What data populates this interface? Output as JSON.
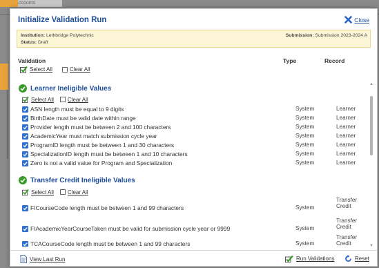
{
  "background": {
    "crumb": "Code Accounts"
  },
  "dialog": {
    "title": "Initialize Validation Run",
    "close_label": "Close",
    "info": {
      "institution_label": "Institution:",
      "institution_value": "Lethbridge Polytechnic",
      "status_label": "Status:",
      "status_value": "Draft",
      "submission_label": "Submission:",
      "submission_value": "Submission 2023-2024 A"
    },
    "columns": {
      "validation": "Validation",
      "type": "Type",
      "record": "Record"
    },
    "select_all": "Select All",
    "clear_all": "Clear All",
    "sections": [
      {
        "title": "Learner Ineligible Values",
        "select_all": "Select All",
        "clear_all": "Clear All",
        "rows": [
          {
            "text": "ASN length must be equal to 9 digits",
            "type": "System",
            "record": "Learner"
          },
          {
            "text": "BirthDate must be valid date within range",
            "type": "System",
            "record": "Learner"
          },
          {
            "text": "Provider length must be between 2 and 100 characters",
            "type": "System",
            "record": "Learner"
          },
          {
            "text": "AcademicYear must match submission cycle year",
            "type": "System",
            "record": "Learner"
          },
          {
            "text": "ProgramID length must be between 1 and 30 characters",
            "type": "System",
            "record": "Learner"
          },
          {
            "text": "SpecializationID length must be between 1 and 10 characters",
            "type": "System",
            "record": "Learner"
          },
          {
            "text": "Zero is not a valid value for Program and Specialization",
            "type": "System",
            "record": "Learner"
          }
        ]
      },
      {
        "title": "Transfer Credit Ineligible Values",
        "select_all": "Select All",
        "clear_all": "Clear All",
        "rows": [
          {
            "text": "FICourseCode length must be between 1 and 99 characters",
            "type": "System",
            "record": "Transfer Credit"
          },
          {
            "text": "FIAcademicYearCourseTaken must be valid for submission cycle year or 9999",
            "type": "System",
            "record": "Transfer Credit"
          },
          {
            "text": "TCACourseCode length must be between 1 and 99 characters",
            "type": "System",
            "record": "Transfer Credit"
          }
        ]
      }
    ],
    "footer": {
      "view_last_run": "View Last Run",
      "run_validations": "Run Validations",
      "reset": "Reset"
    }
  },
  "colors": {
    "title_blue": "#1f4e9a",
    "check_green": "#3a9a2a",
    "info_bg": "#fdf6d6",
    "close_blue": "#2a62c9"
  }
}
